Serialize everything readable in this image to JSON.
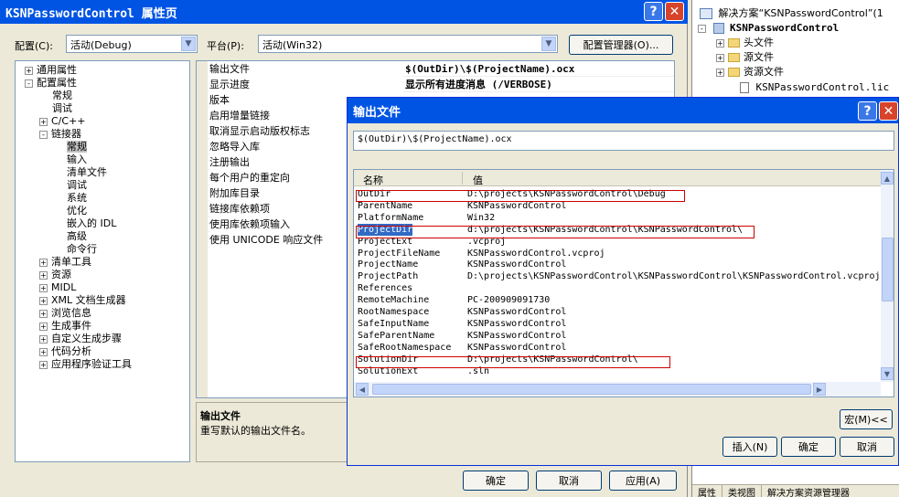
{
  "main": {
    "title": "KSNPasswordControl 属性页",
    "config_label": "配置(C):",
    "config_value": "活动(Debug)",
    "platform_label": "平台(P):",
    "platform_value": "活动(Win32)",
    "config_manager": "配置管理器(O)...",
    "tree": [
      {
        "label": "通用属性",
        "exp": "+"
      },
      {
        "label": "配置属性",
        "exp": "-"
      },
      {
        "label": "常规",
        "exp": ""
      },
      {
        "label": "调试",
        "exp": ""
      },
      {
        "label": "C/C++",
        "exp": "+"
      },
      {
        "label": "链接器",
        "exp": "-"
      },
      {
        "label": "常规",
        "exp": ""
      },
      {
        "label": "输入",
        "exp": ""
      },
      {
        "label": "清单文件",
        "exp": ""
      },
      {
        "label": "调试",
        "exp": ""
      },
      {
        "label": "系统",
        "exp": ""
      },
      {
        "label": "优化",
        "exp": ""
      },
      {
        "label": "嵌入的 IDL",
        "exp": ""
      },
      {
        "label": "高级",
        "exp": ""
      },
      {
        "label": "命令行",
        "exp": ""
      },
      {
        "label": "清单工具",
        "exp": "+"
      },
      {
        "label": "资源",
        "exp": "+"
      },
      {
        "label": "MIDL",
        "exp": "+"
      },
      {
        "label": "XML 文档生成器",
        "exp": "+"
      },
      {
        "label": "浏览信息",
        "exp": "+"
      },
      {
        "label": "生成事件",
        "exp": "+"
      },
      {
        "label": "自定义生成步骤",
        "exp": "+"
      },
      {
        "label": "代码分析",
        "exp": "+"
      },
      {
        "label": "应用程序验证工具",
        "exp": "+"
      }
    ],
    "props": [
      {
        "name": "输出文件",
        "value": "$(OutDir)\\$(ProjectName).ocx"
      },
      {
        "name": "显示进度",
        "value": "显示所有进度消息 (/VERBOSE)"
      },
      {
        "name": "版本",
        "value": ""
      },
      {
        "name": "启用增量链接",
        "value": ""
      },
      {
        "name": "取消显示启动版权标志",
        "value": ""
      },
      {
        "name": "忽略导入库",
        "value": ""
      },
      {
        "name": "注册输出",
        "value": ""
      },
      {
        "name": "每个用户的重定向",
        "value": ""
      },
      {
        "name": "附加库目录",
        "value": ""
      },
      {
        "name": "链接库依赖项",
        "value": ""
      },
      {
        "name": "使用库依赖项输入",
        "value": ""
      },
      {
        "name": "使用 UNICODE 响应文件",
        "value": ""
      }
    ],
    "desc_title": "输出文件",
    "desc_text": "重写默认的输出文件名。",
    "ok": "确定",
    "cancel": "取消",
    "apply": "应用(A)"
  },
  "solution": {
    "solution_label": "解决方案“KSNPasswordControl”(1",
    "project": "KSNPasswordControl",
    "items": [
      "头文件",
      "源文件",
      "资源文件"
    ],
    "file": "KSNPasswordControl.lic",
    "tabs": [
      "属性",
      "类视图",
      "解决方案资源管理器"
    ]
  },
  "dialog": {
    "title": "输出文件",
    "input_value": "$(OutDir)\\$(ProjectName).ocx",
    "col_name": "名称",
    "col_value": "值",
    "rows": [
      {
        "k": "OutDir",
        "v": "D:\\projects\\KSNPasswordControl\\Debug"
      },
      {
        "k": "ParentName",
        "v": "KSNPasswordControl"
      },
      {
        "k": "PlatformName",
        "v": "Win32"
      },
      {
        "k": "ProjectDir",
        "v": "d:\\projects\\KSNPasswordControl\\KSNPasswordControl\\"
      },
      {
        "k": "ProjectExt",
        "v": ".vcproj"
      },
      {
        "k": "ProjectFileName",
        "v": "KSNPasswordControl.vcproj"
      },
      {
        "k": "ProjectName",
        "v": "KSNPasswordControl"
      },
      {
        "k": "ProjectPath",
        "v": "D:\\projects\\KSNPasswordControl\\KSNPasswordControl\\KSNPasswordControl.vcproj"
      },
      {
        "k": "References",
        "v": ""
      },
      {
        "k": "RemoteMachine",
        "v": "PC-200909091730"
      },
      {
        "k": "RootNamespace",
        "v": "KSNPasswordControl"
      },
      {
        "k": "SafeInputName",
        "v": "KSNPasswordControl"
      },
      {
        "k": "SafeParentName",
        "v": "KSNPasswordControl"
      },
      {
        "k": "SafeRootNamespace",
        "v": "KSNPasswordControl"
      },
      {
        "k": "SolutionDir",
        "v": "D:\\projects\\KSNPasswordControl\\"
      },
      {
        "k": "SolutionExt",
        "v": ".sln"
      }
    ],
    "macro_btn": "宏(M)<<",
    "insert_btn": "插入(N)",
    "ok": "确定",
    "cancel": "取消"
  }
}
